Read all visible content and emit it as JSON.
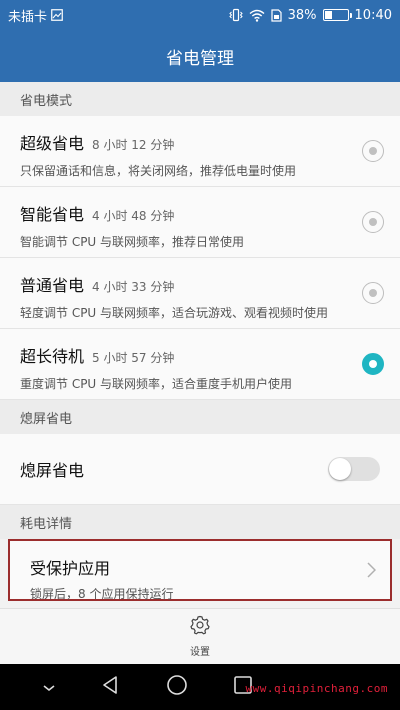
{
  "status_bar": {
    "carrier": "未插卡",
    "battery_percent": "38%",
    "battery_level": 0.38,
    "time": "10:40"
  },
  "header": {
    "title": "省电管理"
  },
  "sections": {
    "power_mode": {
      "label": "省电模式"
    },
    "screen_off": {
      "label": "熄屏省电"
    },
    "consumption": {
      "label": "耗电详情"
    }
  },
  "modes": [
    {
      "title": "超级省电",
      "time": "8 小时 12 分钟",
      "desc": "只保留通话和信息，将关闭网络，推荐低电量时使用",
      "selected": false
    },
    {
      "title": "智能省电",
      "time": "4 小时 48 分钟",
      "desc": "智能调节 CPU 与联网频率，推荐日常使用",
      "selected": false
    },
    {
      "title": "普通省电",
      "time": "4 小时 33 分钟",
      "desc": "轻度调节 CPU 与联网频率，适合玩游戏、观看视频时使用",
      "selected": false
    },
    {
      "title": "超长待机",
      "time": "5 小时 57 分钟",
      "desc": "重度调节 CPU 与联网频率，适合重度手机用户使用",
      "selected": true
    }
  ],
  "screen_off_saving": {
    "title": "熄屏省电",
    "enabled": false
  },
  "protected_apps": {
    "title": "受保护应用",
    "desc": "锁屏后，8 个应用保持运行"
  },
  "bottom_action": {
    "label": "设置"
  },
  "watermark": "www.qiqipinchang.com",
  "colors": {
    "primary": "#2f6eb0",
    "accent": "#1fb5c2",
    "highlight_border": "#9b2d2d"
  }
}
